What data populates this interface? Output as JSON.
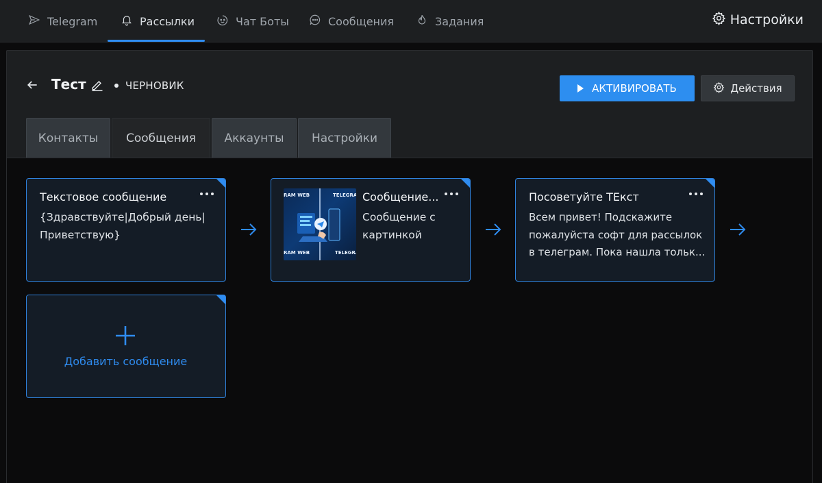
{
  "colors": {
    "accent": "#2F8CF0",
    "background": "#0B0B0C",
    "panel": "#1D1F21",
    "card": "#141C26"
  },
  "nav": {
    "items": [
      {
        "label": "Telegram",
        "icon": "send-icon",
        "active": false
      },
      {
        "label": "Рассылки",
        "icon": "bell-icon",
        "active": true
      },
      {
        "label": "Чат Боты",
        "icon": "bot-icon",
        "active": false
      },
      {
        "label": "Сообщения",
        "icon": "chat-icon",
        "active": false
      },
      {
        "label": "Задания",
        "icon": "flame-icon",
        "active": false
      }
    ],
    "settings_label": "Настройки"
  },
  "header": {
    "title": "Тест",
    "status": "ЧЕРНОВИК",
    "activate_label": "АКТИВИРОВАТЬ",
    "actions_label": "Действия"
  },
  "tabs": [
    {
      "label": "Контакты",
      "active": false
    },
    {
      "label": "Сообщения",
      "active": true
    },
    {
      "label": "Аккаунты",
      "active": false
    },
    {
      "label": "Настройки",
      "active": false
    }
  ],
  "messages": [
    {
      "title": "Текстовое сообщение",
      "body": "{Здравствуйте|Добрый день|\nПриветствую}",
      "has_image": false
    },
    {
      "title": "Сообщение...",
      "body": "Сообщение с\nкартинкой",
      "has_image": true,
      "image_text": [
        "RAM WEB",
        "TELEGRA",
        "RAM WEB",
        "TELEGRA"
      ]
    },
    {
      "title": "Посоветуйте ТЕкст",
      "body": "Всем привет! Подскажите\nпожалуйста софт для рассылок\nв телеграм. Пока нашла тольк...",
      "has_image": false
    }
  ],
  "add_message_label": "Добавить сообщение"
}
